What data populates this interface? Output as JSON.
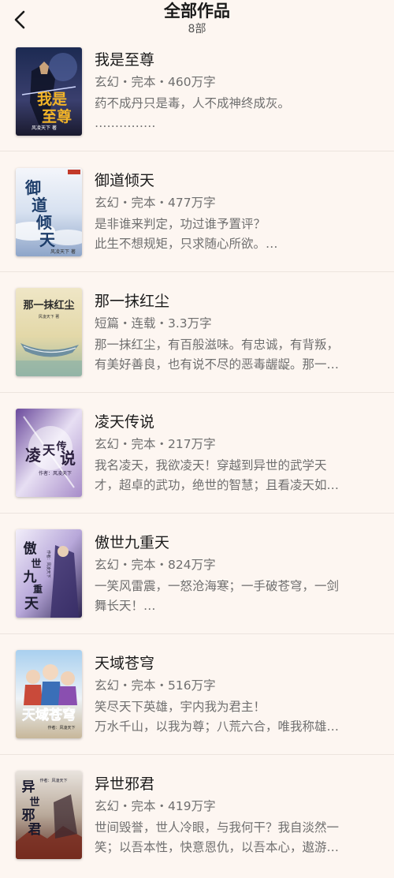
{
  "header": {
    "title": "全部作品",
    "count": "8部"
  },
  "books": [
    {
      "title": "我是至尊",
      "meta": "玄幻・完本・460万字",
      "desc_line1": "药不成丹只是毒，人不成神终成灰。",
      "desc_line2": "……………",
      "cover_text": "我是至尊",
      "cover_author": "风凌天下 著",
      "cover_icon": "cover-warrior"
    },
    {
      "title": "御道倾天",
      "meta": "玄幻・完本・477万字",
      "desc_line1": "是非谁来判定，功过谁予置评？",
      "desc_line2": "此生不想规矩，只求随心所欲。…",
      "cover_text": "御道倾天",
      "cover_author": "风凌天下 著",
      "cover_icon": "cover-sky"
    },
    {
      "title": "那一抹红尘",
      "meta": "短篇・连载・3.3万字",
      "desc_line1": "那一抹红尘，有百般滋味。有忠诚，有背叛，",
      "desc_line2": "有美好善良，也有说不尽的恶毒龌龊。那一…",
      "cover_text": "那一抹红尘",
      "cover_author": "风凌天下 著",
      "cover_icon": "cover-boat"
    },
    {
      "title": "凌天传说",
      "meta": "玄幻・完本・217万字",
      "desc_line1": "我名凌天，我欲凌天！穿越到异世的武学天",
      "desc_line2": "才，超卓的武功，绝世的智慧；且看凌天如…",
      "cover_text": "凌天传说",
      "cover_author": "作者：风凌天下",
      "cover_icon": "cover-sword"
    },
    {
      "title": "傲世九重天",
      "meta": "玄幻・完本・824万字",
      "desc_line1": "一笑风雷震，一怒沧海寒；一手破苍穹，一剑",
      "desc_line2": "舞长天！…",
      "cover_text": "傲世九重天",
      "cover_author": "作者：风凌天下",
      "cover_icon": "cover-mage"
    },
    {
      "title": "天域苍穹",
      "meta": "玄幻・完本・516万字",
      "desc_line1": "笑尽天下英雄，宇内我为君主！",
      "desc_line2": "万水千山，以我为尊；八荒六合，唯我称雄…",
      "cover_text": "天域苍穹",
      "cover_author": "作者：风凌天下",
      "cover_icon": "cover-heroes"
    },
    {
      "title": "异世邪君",
      "meta": "玄幻・完本・419万字",
      "desc_line1": "世间毁誉，世人冷眼，与我何干？我自淡然一",
      "desc_line2": "笑；以吾本性，快意恩仇，以吾本心，遨游…",
      "cover_text": "异世邪君",
      "cover_author": "作者：风凌天下",
      "cover_icon": "cover-battle"
    }
  ],
  "colors": {
    "background": "#fdf6f1",
    "title_text": "#1b1b1b",
    "meta_text": "#6f6f6f"
  }
}
